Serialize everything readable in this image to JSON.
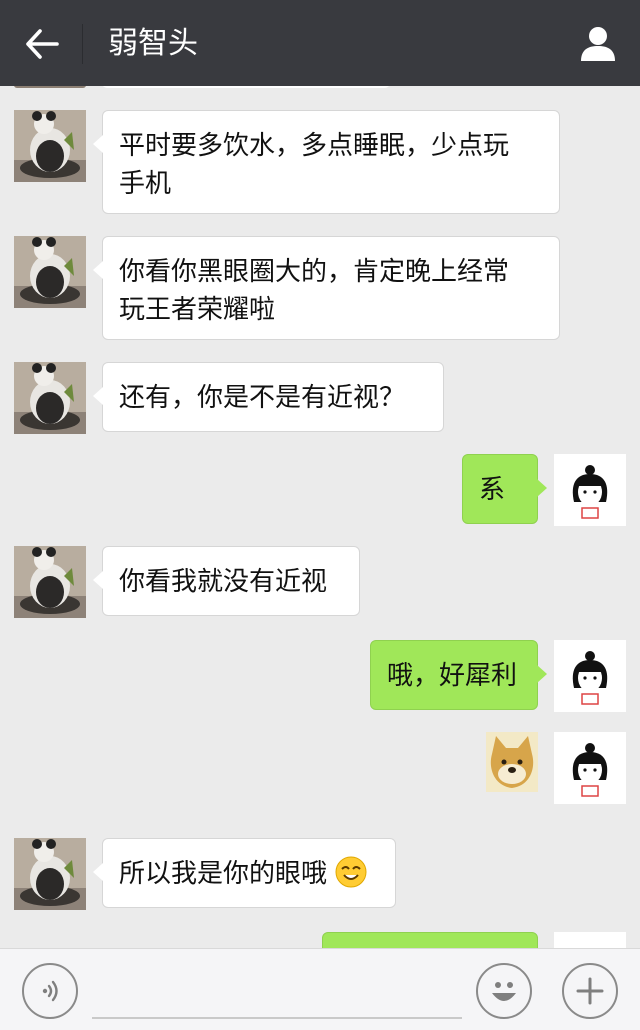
{
  "header": {
    "title": "弱智头",
    "back_icon": "back-arrow-icon",
    "profile_icon": "person-icon"
  },
  "messages": [
    {
      "side": "left",
      "text": "平时要多饮水，多点睡眠，少点玩\n手机"
    },
    {
      "side": "left",
      "text": "你看你黑眼圈大的，肯定晚上经常\n玩王者荣耀啦"
    },
    {
      "side": "left",
      "text": "还有，你是不是有近视？"
    },
    {
      "side": "right",
      "text": "系"
    },
    {
      "side": "left",
      "text": "你看我就没有近视"
    },
    {
      "side": "right",
      "text": "哦，好犀利"
    },
    {
      "side": "right",
      "sticker": "doge-sticker"
    },
    {
      "side": "left",
      "text": "所以我是你的眼哦",
      "emoji": "squinting-smile-emoji"
    }
  ],
  "input_bar": {
    "voice_icon": "voice-icon",
    "emoji_icon": "emoji-smile-icon",
    "plus_icon": "plus-icon"
  },
  "colors": {
    "topbar": "#393a3f",
    "background": "#ebebeb",
    "bubble_self": "#a0e759",
    "bubble_other": "#ffffff"
  }
}
